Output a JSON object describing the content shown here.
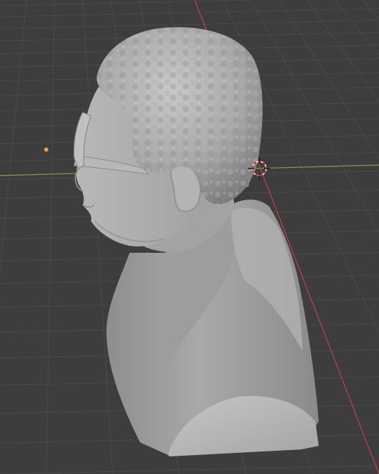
{
  "viewport": {
    "colors": {
      "background": "#3d3d3d",
      "grid_line": "#4a4a4a",
      "x_axis": "#c2404a",
      "y_axis": "#7aa83a",
      "light_origin": "#f0a030",
      "model_base": "#9a9a9a",
      "model_light": "#c4c4c4",
      "model_shadow": "#6e6e6e",
      "cursor_ring": "#e0e0e0",
      "cursor_dash": "#d03030"
    },
    "icons": [
      "3d-cursor-icon",
      "light-origin-icon"
    ],
    "objects": [
      "sculpted-bust-mesh"
    ]
  }
}
